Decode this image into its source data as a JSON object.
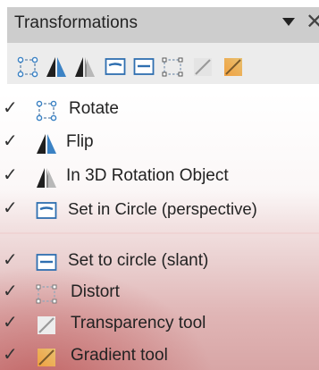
{
  "toolbar": {
    "title": "Transformations",
    "icons": [
      {
        "name": "rotate-icon"
      },
      {
        "name": "flip-icon"
      },
      {
        "name": "3d-rotation-object-icon"
      },
      {
        "name": "set-in-circle-perspective-icon"
      },
      {
        "name": "set-to-circle-slant-icon"
      },
      {
        "name": "distort-icon"
      },
      {
        "name": "transparency-tool-icon"
      },
      {
        "name": "gradient-tool-icon"
      }
    ],
    "menu_arrow_icon": "chevron-down-icon",
    "close_icon": "close-icon"
  },
  "menu": {
    "items": [
      {
        "label": "Rotate",
        "checked": true,
        "icon": "rotate-icon"
      },
      {
        "label": "Flip",
        "checked": true,
        "icon": "flip-icon"
      },
      {
        "label": "In 3D Rotation Object",
        "checked": true,
        "icon": "3d-rotation-object-icon"
      },
      {
        "label": "Set in Circle (perspective)",
        "checked": true,
        "icon": "set-in-circle-perspective-icon"
      },
      {
        "label": "Set to circle (slant)",
        "checked": true,
        "icon": "set-to-circle-slant-icon"
      },
      {
        "label": "Distort",
        "checked": true,
        "icon": "distort-icon"
      },
      {
        "label": "Transparency tool",
        "checked": true,
        "icon": "transparency-tool-icon"
      },
      {
        "label": "Gradient tool",
        "checked": true,
        "icon": "gradient-tool-icon"
      }
    ],
    "check_glyph": "✓"
  },
  "colors": {
    "toolbar_bg": "#ececec",
    "title_bar_bg": "#cdcdcd",
    "icon_blue": "#3b82c4",
    "menu_highlight": "#c03a3a"
  }
}
